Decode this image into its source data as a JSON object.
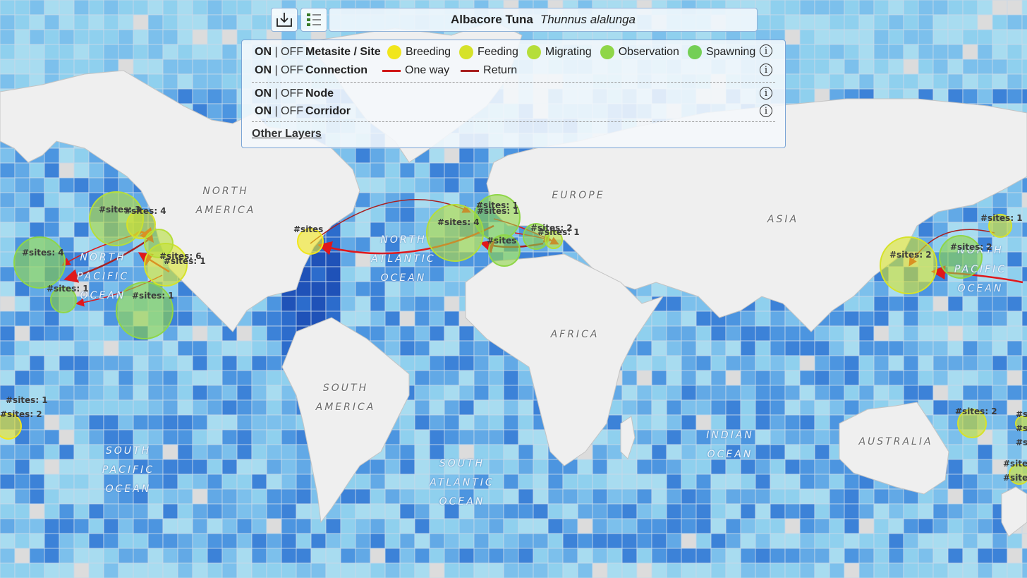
{
  "title": {
    "common": "Albacore Tuna",
    "scientific": "Thunnus alalunga"
  },
  "toolbar": {
    "download_icon": "download-tray-icon",
    "legend_icon": "layer-list-icon"
  },
  "layers": [
    {
      "on": "ON",
      "sep": " | ",
      "off": "OFF",
      "name": "Metasite / Site"
    },
    {
      "on": "ON",
      "sep": " | ",
      "off": "OFF",
      "name": "Connection"
    },
    {
      "on": "ON",
      "sep": " | ",
      "off": "OFF",
      "name": "Node"
    },
    {
      "on": "ON",
      "sep": " | ",
      "off": "OFF",
      "name": "Corridor"
    }
  ],
  "site_legend": [
    {
      "label": "Breeding",
      "color": "#f1e61c"
    },
    {
      "label": "Feeding",
      "color": "#d6e22a"
    },
    {
      "label": "Migrating",
      "color": "#b5de3a"
    },
    {
      "label": "Observation",
      "color": "#8fd648"
    },
    {
      "label": "Spawning",
      "color": "#74cf55"
    }
  ],
  "connection_legend": [
    {
      "label": "One way",
      "color": "#d01818"
    },
    {
      "label": "Return",
      "color": "#a82020"
    }
  ],
  "info_glyph": "i",
  "other_layers": "Other Layers",
  "map_labels": {
    "north_america": [
      "NORTH",
      "AMERICA"
    ],
    "south_america": [
      "SOUTH",
      "AMERICA"
    ],
    "europe": "EUROPE",
    "asia": "ASIA",
    "africa": "AFRICA",
    "australia": "AUSTRALIA",
    "north_atlantic": [
      "NORTH",
      "ATLANTIC",
      "OCEAN"
    ],
    "south_atlantic": [
      "SOUTH",
      "ATLANTIC",
      "OCEAN"
    ],
    "indian": [
      "INDIAN",
      "OCEAN"
    ],
    "south_pacific": [
      "SOUTH",
      "PACIFIC",
      "OCEAN"
    ],
    "north_pacific_east": [
      "NORTH",
      "PACIFIC",
      "OCEAN"
    ],
    "north_pacific_west": [
      "NORTH",
      "PACIFIC",
      "OCEAN"
    ]
  },
  "site_labels": [
    "#sites: 3",
    "#sites: 4",
    "#sites: 4",
    "#sites: 6",
    "#sites: 1",
    "#sites: 1",
    "#sites: 1",
    "#sites",
    "#sites: 4",
    "#sites: 1",
    "#sites: 1",
    "#sites",
    "#sites: 2",
    "#sites: 1",
    "#sites: 2",
    "#sites: 1",
    "#sites: 2",
    "#sites: 2",
    "#sites: 1",
    "#sites: 2",
    "#sites",
    "#sites",
    "#sites: 1",
    "#sites: 1",
    "#sites"
  ],
  "colors": {
    "land": "#eeeeee",
    "border": "#b8b8b8",
    "connection": "#e0181b",
    "return": "#a82020"
  }
}
